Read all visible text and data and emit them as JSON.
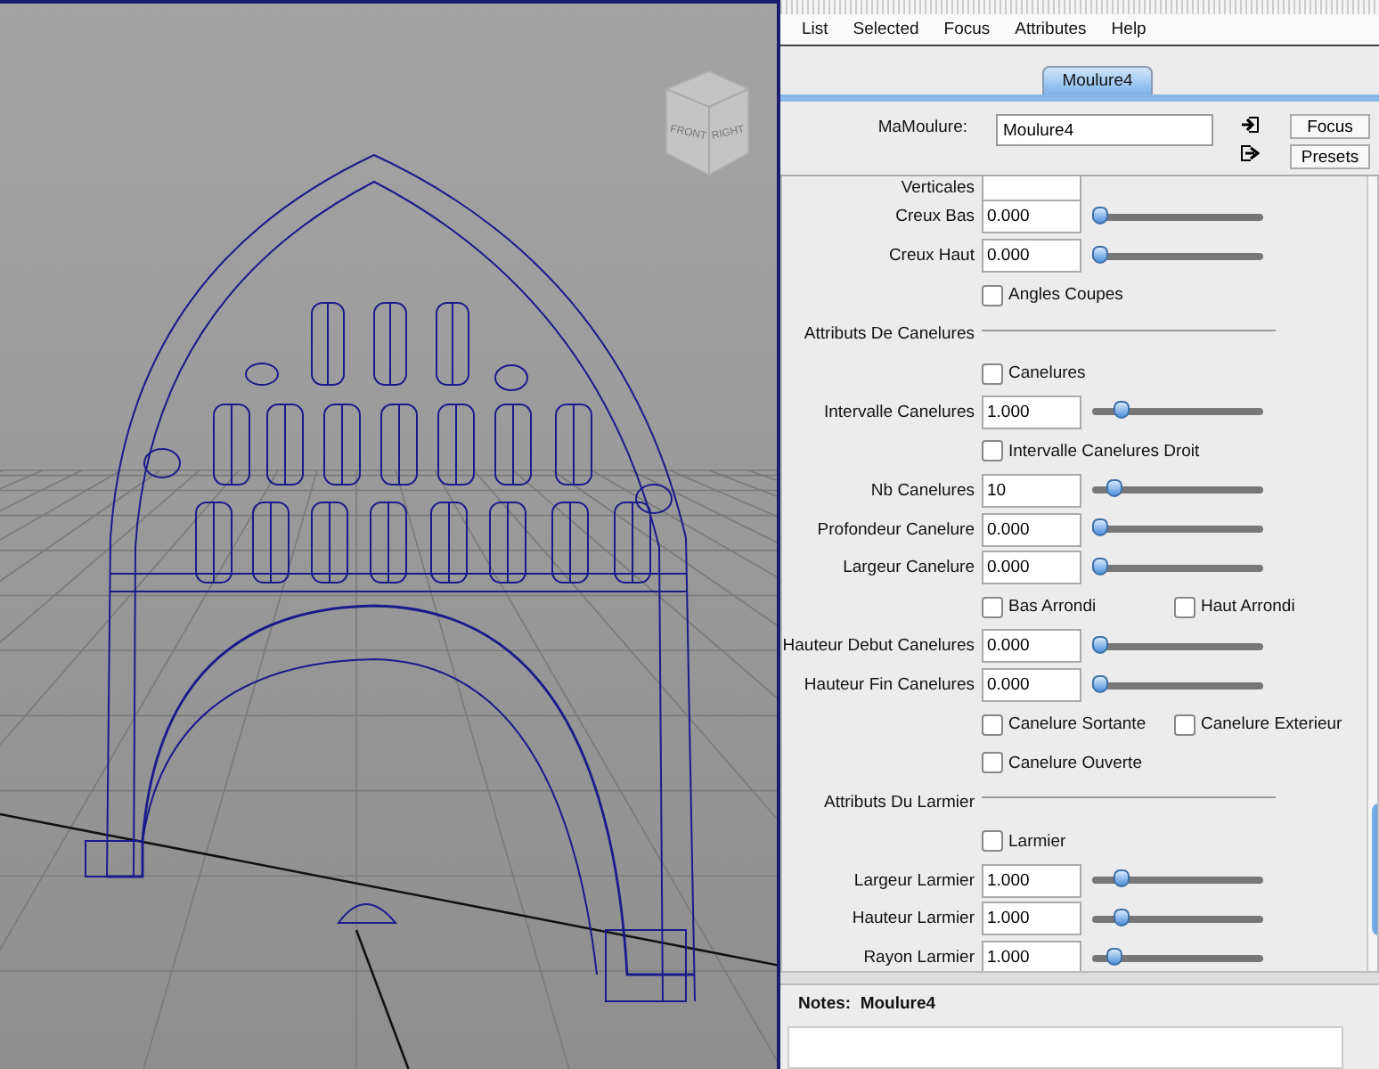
{
  "viewport": {
    "view_cube": [
      "FRONT",
      "RIGHT"
    ]
  },
  "menu": [
    "List",
    "Selected",
    "Focus",
    "Attributes",
    "Help"
  ],
  "tabs": [
    {
      "label": "Moulure4",
      "selected": true
    }
  ],
  "name_field": {
    "label": "MaMoulure:",
    "value": "Moulure4"
  },
  "buttons": [
    "Focus",
    "Presets"
  ],
  "attributes": [
    {
      "kind": "partial",
      "label": "Verticales"
    },
    {
      "kind": "slider",
      "label": "Creux Bas",
      "value": "0.000",
      "level": 0
    },
    {
      "kind": "slider",
      "label": "Creux Haut",
      "value": "0.000",
      "level": 0
    },
    {
      "kind": "checks",
      "items": [
        {
          "label": "Angles Coupes",
          "checked": false
        }
      ]
    },
    {
      "kind": "section",
      "label": "Attributs De Canelures"
    },
    {
      "kind": "checks",
      "items": [
        {
          "label": "Canelures",
          "checked": false
        }
      ]
    },
    {
      "kind": "slider",
      "label": "Intervalle Canelures",
      "value": "1.000",
      "level": 0.14
    },
    {
      "kind": "checks",
      "items": [
        {
          "label": "Intervalle Canelures Droit",
          "checked": false
        }
      ]
    },
    {
      "kind": "slider",
      "label": "Nb Canelures",
      "value": "10",
      "level": 0.09
    },
    {
      "kind": "slider",
      "label": "Profondeur Canelure",
      "value": "0.000",
      "level": 0
    },
    {
      "kind": "slider",
      "label": "Largeur Canelure",
      "value": "0.000",
      "level": 0
    },
    {
      "kind": "checks",
      "items": [
        {
          "label": "Bas Arrondi",
          "checked": false
        },
        {
          "label": "Haut Arrondi",
          "checked": false
        }
      ]
    },
    {
      "kind": "slider",
      "label": "Hauteur Debut Canelures",
      "value": "0.000",
      "level": 0
    },
    {
      "kind": "slider",
      "label": "Hauteur Fin Canelures",
      "value": "0.000",
      "level": 0
    },
    {
      "kind": "checks",
      "items": [
        {
          "label": "Canelure Sortante",
          "checked": false
        },
        {
          "label": "Canelure Exterieur",
          "checked": false
        }
      ]
    },
    {
      "kind": "checks",
      "items": [
        {
          "label": "Canelure Ouverte",
          "checked": false
        }
      ]
    },
    {
      "kind": "section",
      "label": "Attributs Du Larmier"
    },
    {
      "kind": "checks",
      "items": [
        {
          "label": "Larmier",
          "checked": false
        }
      ]
    },
    {
      "kind": "slider",
      "label": "Largeur Larmier",
      "value": "1.000",
      "level": 0.14
    },
    {
      "kind": "slider",
      "label": "Hauteur Larmier",
      "value": "1.000",
      "level": 0.14
    },
    {
      "kind": "slider",
      "label": "Rayon Larmier",
      "value": "1.000",
      "level": 0.09
    }
  ],
  "notes": {
    "label": "Notes:",
    "title": "Moulure4"
  }
}
